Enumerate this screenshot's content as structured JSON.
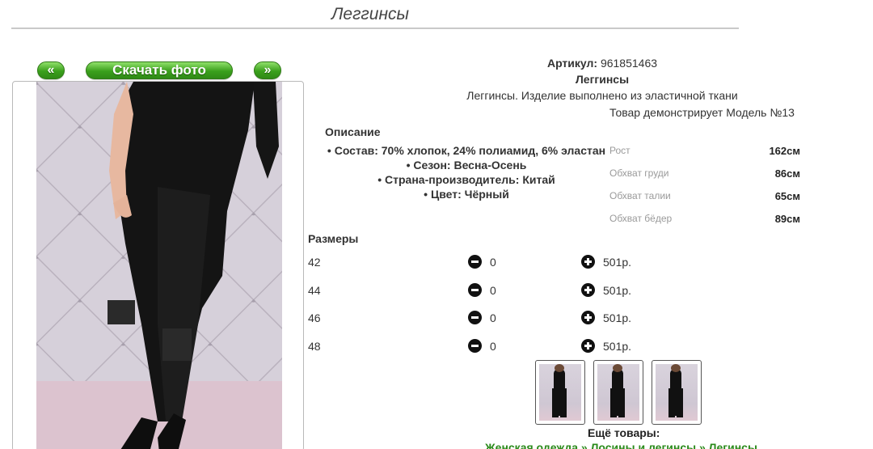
{
  "page": {
    "title": "Леггинсы"
  },
  "photo_nav": {
    "prev_label": "«",
    "download_label": "Скачать фото",
    "next_label": "»"
  },
  "product": {
    "article_label": "Артикул:",
    "article_value": "961851463",
    "name": "Леггинсы",
    "description": "Леггинсы. Изделие выполнено из эластичной ткани",
    "model_note": "Товар демонстрирует Модель №13"
  },
  "description_section": {
    "heading": "Описание",
    "items": [
      "Состав: 70% хлопок, 24% полиамид, 6% эластан",
      "Сезон: Весна-Осень",
      "Страна-производитель: Китай",
      "Цвет: Чёрный"
    ]
  },
  "model_params": [
    {
      "label": "Рост",
      "value": "162см"
    },
    {
      "label": "Обхват груди",
      "value": "86см"
    },
    {
      "label": "Обхват талии",
      "value": "65см"
    },
    {
      "label": "Обхват бёдер",
      "value": "89см"
    }
  ],
  "sizes": {
    "heading": "Размеры",
    "rows": [
      {
        "size": "42",
        "qty": "0",
        "price": "501р."
      },
      {
        "size": "44",
        "qty": "0",
        "price": "501р."
      },
      {
        "size": "46",
        "qty": "0",
        "price": "501р."
      },
      {
        "size": "48",
        "qty": "0",
        "price": "501р."
      }
    ]
  },
  "more": {
    "heading": "Ещё товары:",
    "breadcrumbs": [
      "Женская одежда",
      "Лосины и легинсы",
      "Легинсы"
    ],
    "separator": "»"
  },
  "icons": {
    "minus": "minus-circle-icon",
    "plus": "plus-circle-icon"
  },
  "colors": {
    "accent_green": "#3aa01c",
    "link_green": "#2a8a1a"
  }
}
